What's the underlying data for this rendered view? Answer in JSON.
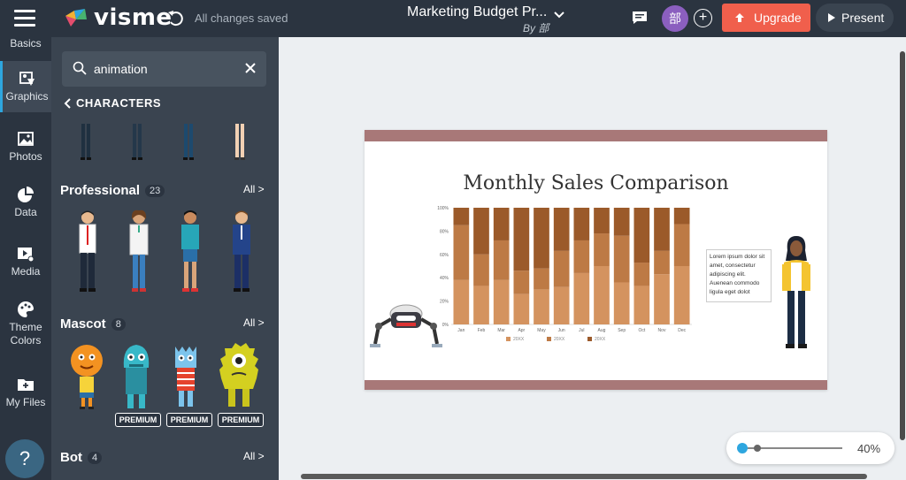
{
  "topbar": {
    "logo_text": "visme",
    "save_status": "All changes saved",
    "doc_title": "Marketing Budget Pr...",
    "doc_by": "By 部",
    "avatar_initial": "部",
    "add_label": "+",
    "upgrade_label": "Upgrade",
    "present_label": "Present"
  },
  "rail": {
    "items": [
      {
        "label": "Basics",
        "icon": "shapes-icon"
      },
      {
        "label": "Graphics",
        "icon": "graphics-icon"
      },
      {
        "label": "Photos",
        "icon": "photo-icon"
      },
      {
        "label": "Data",
        "icon": "pie-chart-icon"
      },
      {
        "label": "Media",
        "icon": "media-icon"
      },
      {
        "label": "Theme",
        "label2": "Colors",
        "icon": "palette-icon"
      },
      {
        "label": "My Files",
        "icon": "folder-icon"
      }
    ],
    "help_label": "?"
  },
  "panel": {
    "search_value": "animation",
    "back_label": "CHARACTERS",
    "sections": [
      {
        "title": "Professional",
        "count": "23",
        "all_label": "All >"
      },
      {
        "title": "Mascot",
        "count": "8",
        "all_label": "All >"
      },
      {
        "title": "Bot",
        "count": "4",
        "all_label": "All >"
      }
    ],
    "premium_label": "PREMIUM"
  },
  "slide": {
    "title": "Monthly Sales Comparison",
    "text_box": "Lorem ipsum dolor sit amet, consectetur adipiscing elit. Auenean commodo ligula eget dolot"
  },
  "chart_data": {
    "type": "bar",
    "stacked": true,
    "percent": true,
    "categories": [
      "Jan",
      "Feb",
      "Mar",
      "Apr",
      "May",
      "Jun",
      "Jul",
      "Aug",
      "Sep",
      "Oct",
      "Nov",
      "Dec"
    ],
    "series": [
      {
        "name": "20XX",
        "color": "#d4935f",
        "values": [
          38,
          33,
          38,
          26,
          30,
          32,
          44,
          50,
          36,
          33,
          43,
          50
        ]
      },
      {
        "name": "20XX",
        "color": "#bd7a45",
        "values": [
          47,
          27,
          34,
          20,
          18,
          31,
          28,
          28,
          40,
          20,
          20,
          36
        ]
      },
      {
        "name": "20XX",
        "color": "#9b5a2a",
        "values": [
          15,
          40,
          28,
          54,
          52,
          37,
          28,
          22,
          24,
          47,
          37,
          14
        ]
      }
    ],
    "yticks": [
      "0%",
      "20%",
      "40%",
      "60%",
      "80%",
      "100%"
    ],
    "ylim": [
      0,
      100
    ],
    "legend": "bottom"
  },
  "zoom": {
    "value": "40%",
    "level": 0.1
  }
}
